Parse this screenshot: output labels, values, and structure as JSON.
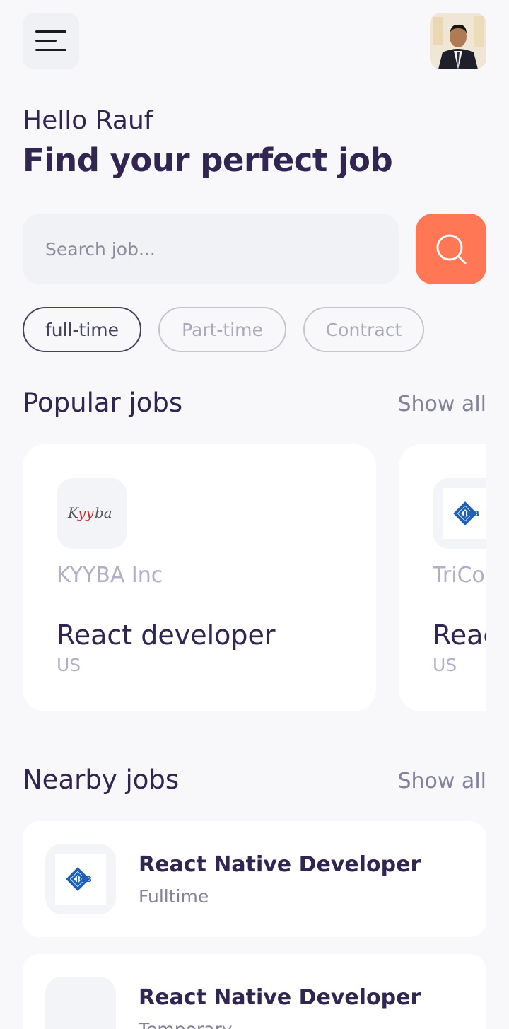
{
  "header": {
    "greeting": "Hello Rauf",
    "headline": "Find your perfect job"
  },
  "search": {
    "placeholder": "Search job...",
    "value": ""
  },
  "tabs": [
    {
      "label": "full-time",
      "active": true
    },
    {
      "label": "Part-time",
      "active": false
    },
    {
      "label": "Contract",
      "active": false
    }
  ],
  "popular": {
    "title": "Popular jobs",
    "show_all": "Show all",
    "cards": [
      {
        "company": "KYYBA Inc",
        "logo_text": "Kyyba",
        "title": "React developer",
        "country": "US"
      },
      {
        "company": "TriCo",
        "logo_text": "JOB",
        "title": "React",
        "country": "US"
      }
    ]
  },
  "nearby": {
    "title": "Nearby jobs",
    "show_all": "Show all",
    "items": [
      {
        "title": "React Native Developer",
        "type": "Fulltime",
        "logo_text": "JOB"
      },
      {
        "title": "React Native Developer",
        "type": "Temporary",
        "logo_text": ""
      }
    ]
  },
  "colors": {
    "accent": "#FF7754",
    "primary": "#312651",
    "tertiary": "#444262",
    "gray": "#83829A",
    "background": "#F8F8FB"
  }
}
